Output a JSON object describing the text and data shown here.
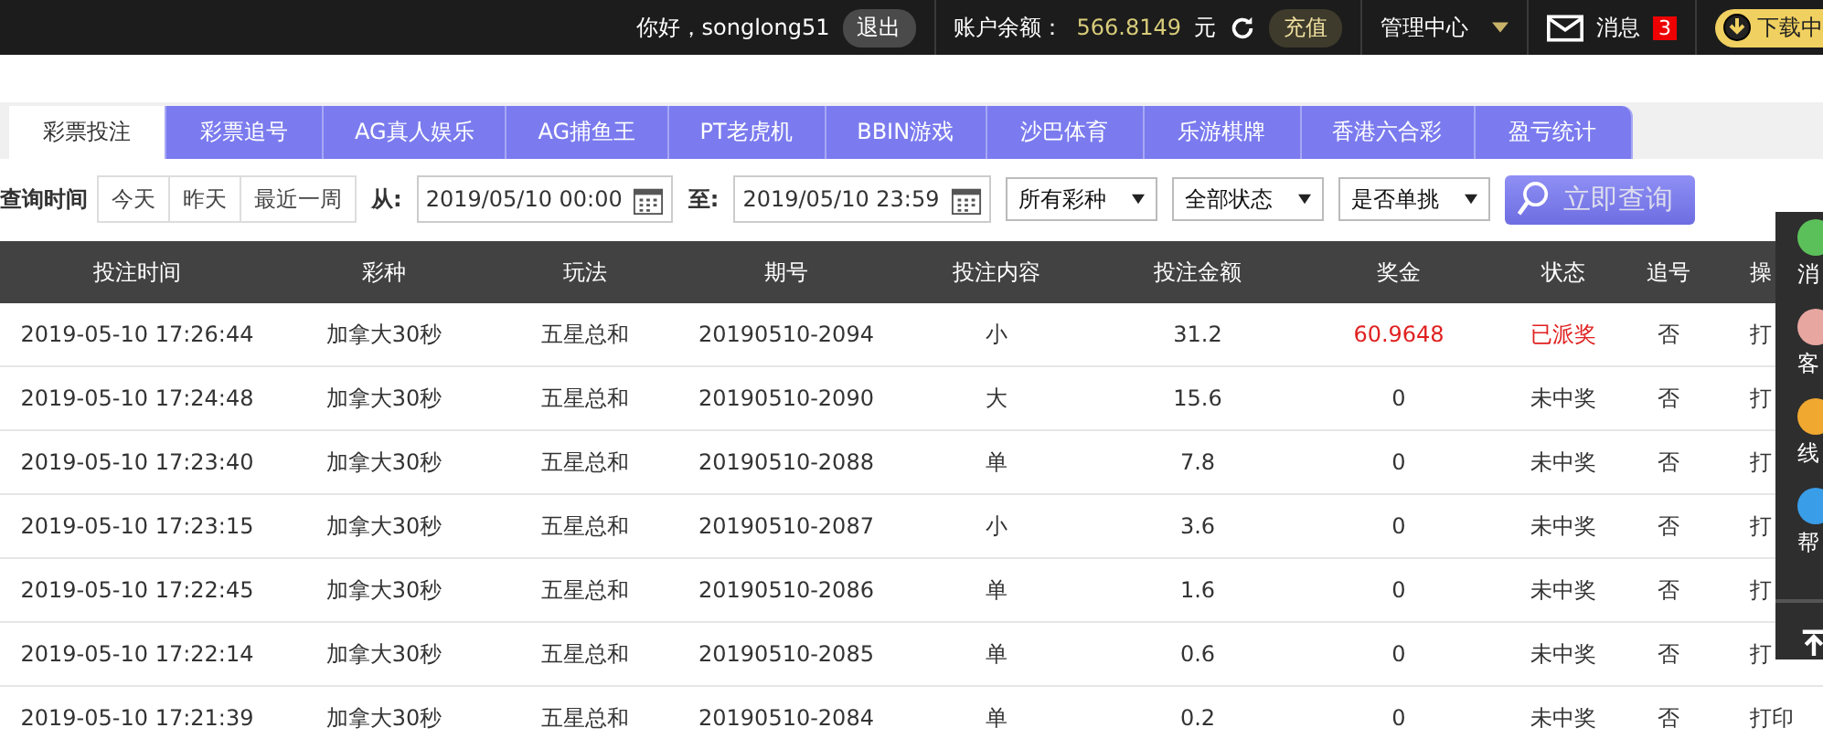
{
  "top_bar": {
    "greeting": "你好，songlong51",
    "logout": "退出",
    "balance_label": "账户余额：",
    "balance": "566.8149",
    "currency": "元",
    "recharge": "充值",
    "admin": "管理中心",
    "messages": "消息",
    "message_count": "3",
    "download": "下载中"
  },
  "tabs": [
    {
      "label": "彩票投注",
      "selected": true
    },
    {
      "label": "彩票追号",
      "selected": false
    },
    {
      "label": "AG真人娱乐",
      "selected": false
    },
    {
      "label": "AG捕鱼王",
      "selected": false
    },
    {
      "label": "PT老虎机",
      "selected": false
    },
    {
      "label": "BBIN游戏",
      "selected": false
    },
    {
      "label": "沙巴体育",
      "selected": false
    },
    {
      "label": "乐游棋牌",
      "selected": false
    },
    {
      "label": "香港六合彩",
      "selected": false
    },
    {
      "label": "盈亏统计",
      "selected": false
    }
  ],
  "filters": {
    "label": "查询时间",
    "quick": [
      "今天",
      "昨天",
      "最近一周"
    ],
    "from_label": "从:",
    "from": "2019/05/10 00:00",
    "to_label": "至:",
    "to": "2019/05/10 23:59",
    "selects": [
      "所有彩种",
      "全部状态",
      "是否单挑"
    ],
    "search": "立即查询"
  },
  "table": {
    "columns": [
      "投注时间",
      "彩种",
      "玩法",
      "期号",
      "投注内容",
      "投注金额",
      "奖金",
      "状态",
      "追号",
      "操"
    ],
    "rows": [
      {
        "cells": [
          "2019-05-10 17:26:44",
          "加拿大30秒",
          "五星总和",
          "20190510-2094",
          "小",
          "31.2",
          "60.9648",
          "已派奖",
          "否",
          "打"
        ],
        "won": true
      },
      {
        "cells": [
          "2019-05-10 17:24:48",
          "加拿大30秒",
          "五星总和",
          "20190510-2090",
          "大",
          "15.6",
          "0",
          "未中奖",
          "否",
          "打"
        ],
        "won": false
      },
      {
        "cells": [
          "2019-05-10 17:23:40",
          "加拿大30秒",
          "五星总和",
          "20190510-2088",
          "单",
          "7.8",
          "0",
          "未中奖",
          "否",
          "打"
        ],
        "won": false
      },
      {
        "cells": [
          "2019-05-10 17:23:15",
          "加拿大30秒",
          "五星总和",
          "20190510-2087",
          "小",
          "3.6",
          "0",
          "未中奖",
          "否",
          "打"
        ],
        "won": false
      },
      {
        "cells": [
          "2019-05-10 17:22:45",
          "加拿大30秒",
          "五星总和",
          "20190510-2086",
          "单",
          "1.6",
          "0",
          "未中奖",
          "否",
          "打"
        ],
        "won": false
      },
      {
        "cells": [
          "2019-05-10 17:22:14",
          "加拿大30秒",
          "五星总和",
          "20190510-2085",
          "单",
          "0.6",
          "0",
          "未中奖",
          "否",
          "打"
        ],
        "won": false
      },
      {
        "cells": [
          "2019-05-10 17:21:39",
          "加拿大30秒",
          "五星总和",
          "20190510-2084",
          "单",
          "0.2",
          "0",
          "未中奖",
          "否",
          "打印"
        ],
        "won": false
      }
    ]
  },
  "side_panel": {
    "items": [
      {
        "label": "消",
        "color": "#5cc05a"
      },
      {
        "label": "客",
        "color": "#e7a6a0"
      },
      {
        "label": "线",
        "color": "#f0a830"
      },
      {
        "label": "帮",
        "color": "#3a9de8"
      }
    ]
  }
}
